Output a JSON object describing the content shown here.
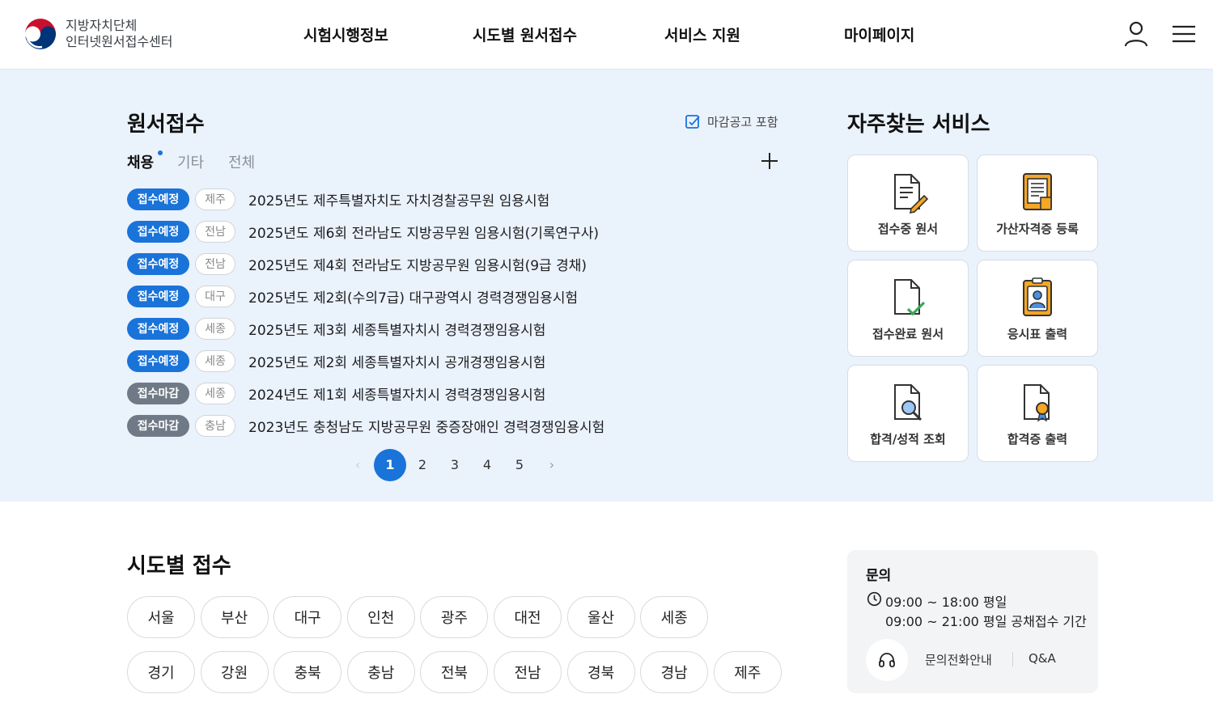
{
  "header": {
    "logo_line1": "지방자치단체",
    "logo_line2": "인터넷원서접수센터",
    "nav": [
      "시험시행정보",
      "시도별 원서접수",
      "서비스 지원",
      "마이페이지"
    ]
  },
  "application": {
    "title": "원서접수",
    "include_closed_label": "마감공고 포함",
    "tabs": [
      "채용",
      "기타",
      "전체"
    ],
    "active_tab": "채용",
    "rows": [
      {
        "status": "접수예정",
        "region": "제주",
        "title": "2025년도 제주특별자치도 자치경찰공무원 임용시험"
      },
      {
        "status": "접수예정",
        "region": "전남",
        "title": "2025년도 제6회 전라남도 지방공무원 임용시험(기록연구사)"
      },
      {
        "status": "접수예정",
        "region": "전남",
        "title": "2025년도 제4회 전라남도 지방공무원 임용시험(9급 경채)"
      },
      {
        "status": "접수예정",
        "region": "대구",
        "title": "2025년도 제2회(수의7급) 대구광역시 경력경쟁임용시험"
      },
      {
        "status": "접수예정",
        "region": "세종",
        "title": "2025년도 제3회 세종특별자치시 경력경쟁임용시험"
      },
      {
        "status": "접수예정",
        "region": "세종",
        "title": "2025년도 제2회 세종특별자치시 공개경쟁임용시험"
      },
      {
        "status": "접수마감",
        "region": "세종",
        "title": "2024년도 제1회 세종특별자치시 경력경쟁임용시험"
      },
      {
        "status": "접수마감",
        "region": "충남",
        "title": "2023년도 충청남도 지방공무원 중증장애인 경력경쟁임용시험"
      }
    ],
    "pages": [
      "1",
      "2",
      "3",
      "4",
      "5"
    ],
    "current_page": "1"
  },
  "services": {
    "title": "자주찾는 서비스",
    "items": [
      {
        "label": "접수중 원서",
        "icon": "document-pencil-icon"
      },
      {
        "label": "가산자격증 등록",
        "icon": "certificate-document-icon"
      },
      {
        "label": "접수완료 원서",
        "icon": "document-check-icon"
      },
      {
        "label": "응시표 출력",
        "icon": "id-card-icon"
      },
      {
        "label": "합격/성적 조회",
        "icon": "document-search-icon"
      },
      {
        "label": "합격증 출력",
        "icon": "document-award-icon"
      }
    ]
  },
  "regions": {
    "title": "시도별 접수",
    "row1": [
      "서울",
      "부산",
      "대구",
      "인천",
      "광주",
      "대전",
      "울산",
      "세종"
    ],
    "row2": [
      "경기",
      "강원",
      "충북",
      "충남",
      "전북",
      "전남",
      "경북",
      "경남",
      "제주"
    ]
  },
  "inquiry": {
    "title": "문의",
    "hours1": "09:00 ~ 18:00 평일",
    "hours2": "09:00 ~ 21:00 평일 공채접수 기간",
    "phone_label": "문의전화안내",
    "qa_label": "Q&A"
  },
  "colors": {
    "primary": "#1a73d9",
    "closed": "#6f7a86",
    "top_bg": "#eaf2fc",
    "icon_orange": "#f5a623"
  }
}
